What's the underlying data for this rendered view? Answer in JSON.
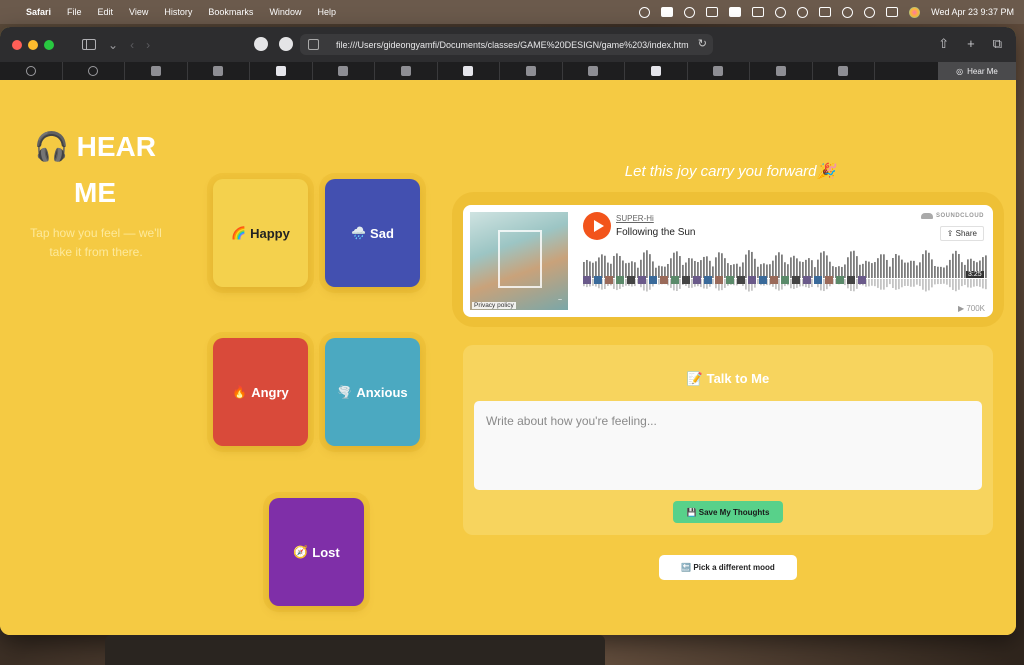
{
  "menubar": {
    "app_name": "Safari",
    "menus": [
      "File",
      "Edit",
      "View",
      "History",
      "Bookmarks",
      "Window",
      "Help"
    ],
    "datetime": "Wed Apr 23  9:37 PM",
    "status_icons": [
      "cloud-sync-icon",
      "g-icon",
      "options-icon",
      "brightness-icon",
      "control-icon",
      "display-icon",
      "moon-icon",
      "play-icon",
      "battery-icon",
      "wifi-icon",
      "search-icon",
      "control-center-icon",
      "siri-icon"
    ]
  },
  "browser": {
    "url": "file:///Users/gideongyamfi/Documents/classes/GAME%20DESIGN/game%203/index.htm",
    "active_tab_title": "Hear Me",
    "tab_count": 15
  },
  "hero": {
    "icon": "🎧",
    "title": "HEAR ME",
    "subtitle": "Tap how you feel — we'll take it from there."
  },
  "moods": [
    {
      "emoji": "🌈",
      "label": "Happy"
    },
    {
      "emoji": "🌧️",
      "label": "Sad"
    },
    {
      "emoji": "🔥",
      "label": "Angry"
    },
    {
      "emoji": "🌪️",
      "label": "Anxious"
    },
    {
      "emoji": "🧭",
      "label": "Lost"
    }
  ],
  "player_section": {
    "tagline": "Let this joy carry you forward",
    "tagline_emoji": "🎉",
    "artist": "SUPER-Hi",
    "track": "Following the Sun",
    "brand": "SOUNDCLOUD",
    "share_label": "Share",
    "duration": "3:25",
    "plays": "▶ 700K",
    "privacy": "Privacy policy"
  },
  "journal": {
    "title": "📝 Talk to Me",
    "placeholder": "Write about how you're feeling...",
    "save_label": "💾 Save My Thoughts"
  },
  "pick_mood_label": "🔙 Pick a different mood",
  "colors": {
    "page_bg": "#f5ca43",
    "happy": "#f4d14d",
    "sad": "#4350b0",
    "angry": "#d94a3a",
    "anxious": "#4ba9c1",
    "lost": "#7f2fa8",
    "save_button": "#58d18a",
    "play_button": "#f2541b"
  }
}
